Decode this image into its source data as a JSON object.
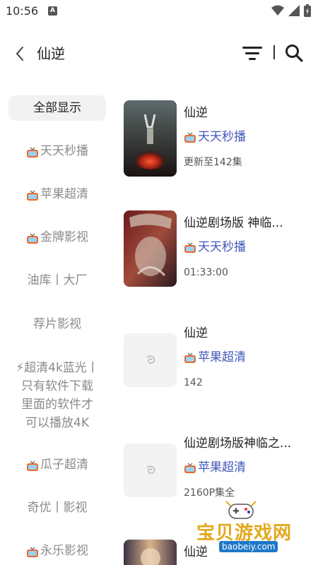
{
  "status_bar": {
    "time": "10:56",
    "notification_letter": "A"
  },
  "header": {
    "title": "仙逆"
  },
  "sidebar": {
    "items": [
      {
        "label": "全部显示",
        "active": true,
        "tv": false
      },
      {
        "label": "天天秒播",
        "active": false,
        "tv": true
      },
      {
        "label": "苹果超清",
        "active": false,
        "tv": true
      },
      {
        "label": "金牌影视",
        "active": false,
        "tv": true
      },
      {
        "label": "油库丨大厂",
        "active": false,
        "tv": false
      },
      {
        "label": "荐片影视",
        "active": false,
        "tv": false
      },
      {
        "label": "⚡超清4k蓝光丨只有软件下载里面的软件才可以播放4K",
        "active": false,
        "tv": false
      },
      {
        "label": "瓜子超清",
        "active": false,
        "tv": true
      },
      {
        "label": "奇优丨影视",
        "active": false,
        "tv": false
      },
      {
        "label": "永乐影视",
        "active": false,
        "tv": true
      }
    ]
  },
  "results": [
    {
      "title": "仙逆",
      "source": "天天秒播",
      "meta": "更新至142集",
      "poster": "image"
    },
    {
      "title": "仙逆剧场版 神临...",
      "source": "天天秒播",
      "meta": "01:33:00",
      "poster": "image"
    },
    {
      "title": "仙逆",
      "source": "苹果超清",
      "meta": "142",
      "poster": "placeholder"
    },
    {
      "title": "仙逆剧场版神临之...",
      "source": "苹果超清",
      "meta": "2160P集全",
      "poster": "placeholder"
    },
    {
      "title": "仙逆",
      "source": "",
      "meta": "",
      "poster": "image"
    }
  ],
  "watermark": {
    "text": "宝贝游戏网",
    "url": "baobeiy.com"
  },
  "colors": {
    "source_link": "#4157b8",
    "active_bg": "#f2f2f2",
    "watermark": "#e3a81c"
  }
}
